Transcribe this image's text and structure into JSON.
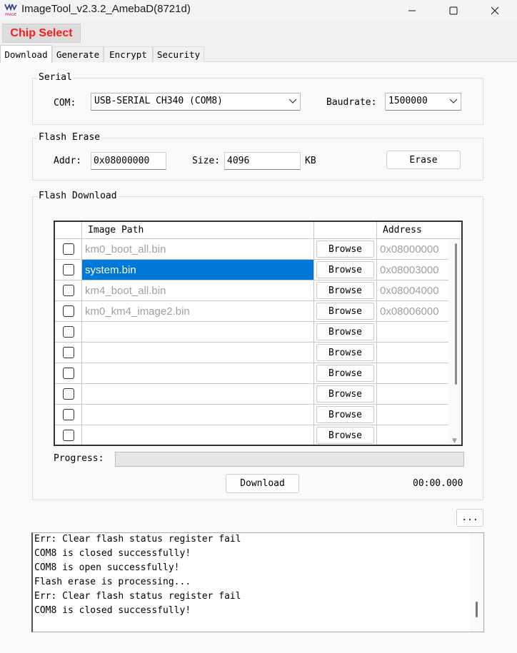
{
  "window": {
    "title": "ImageTool_v2.3.2_AmebaD(8721d)",
    "icon": "app-logo-icon",
    "controls": [
      "minimize-icon",
      "maximize-icon",
      "close-icon"
    ]
  },
  "toolbar": {
    "chip_select_label": "Chip Select",
    "chip_select_color": "#ff1a1a"
  },
  "tabs": [
    {
      "label": "Download",
      "active": true
    },
    {
      "label": "Generate",
      "active": false
    },
    {
      "label": "Encrypt",
      "active": false
    },
    {
      "label": "Security",
      "active": false
    }
  ],
  "serial": {
    "group_label": "Serial",
    "com_label": "COM:",
    "com_value": "USB-SERIAL CH340 (COM8)",
    "baudrate_label": "Baudrate:",
    "baudrate_value": "1500000"
  },
  "flash_erase": {
    "group_label": "Flash Erase",
    "addr_label": "Addr:",
    "addr_value": "0x08000000",
    "size_label": "Size:",
    "size_value": "4096",
    "size_unit": "KB",
    "erase_label": "Erase"
  },
  "flash_download": {
    "group_label": "Flash Download",
    "columns": {
      "image_path": "Image Path",
      "address": "Address"
    },
    "browse_label": "Browse",
    "rows": [
      {
        "path": "km0_boot_all.bin",
        "address": "0x08000000",
        "checked": false,
        "selected": false
      },
      {
        "path": "system.bin",
        "address": "0x08003000",
        "checked": false,
        "selected": true
      },
      {
        "path": "km4_boot_all.bin",
        "address": "0x08004000",
        "checked": false,
        "selected": false
      },
      {
        "path": "km0_km4_image2.bin",
        "address": "0x08006000",
        "checked": false,
        "selected": false
      },
      {
        "path": "",
        "address": "",
        "checked": false,
        "selected": false
      },
      {
        "path": "",
        "address": "",
        "checked": false,
        "selected": false
      },
      {
        "path": "",
        "address": "",
        "checked": false,
        "selected": false
      },
      {
        "path": "",
        "address": "",
        "checked": false,
        "selected": false
      },
      {
        "path": "",
        "address": "",
        "checked": false,
        "selected": false
      },
      {
        "path": "",
        "address": "",
        "checked": false,
        "selected": false
      }
    ],
    "progress_label": "Progress:",
    "progress_value": 0,
    "download_label": "Download",
    "elapsed_time": "00:00.000"
  },
  "more_button_label": "...",
  "log": {
    "lines": [
      "Err: Clear flash status register fail",
      "COM8 is closed successfully!",
      "COM8 is open successfully!",
      "Flash erase is processing...",
      "Err: Clear flash status register fail",
      "COM8 is closed successfully!"
    ]
  },
  "colors": {
    "selection": "#0078d7",
    "disabled_text": "#a0a0a0"
  }
}
